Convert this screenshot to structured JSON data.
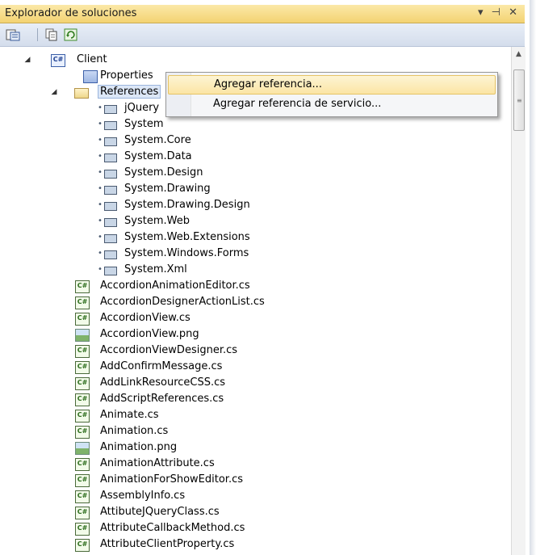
{
  "panel": {
    "title": "Explorador de soluciones",
    "controls": "▾ ⊣ ✕"
  },
  "toolbar": {
    "buttons": [
      {
        "name": "properties-button",
        "icon": "properties-icon"
      },
      {
        "name": "show-all-files-button",
        "icon": "show-all-files-icon"
      },
      {
        "name": "refresh-button",
        "icon": "refresh-icon"
      }
    ]
  },
  "tree": {
    "project": {
      "label": "Client",
      "icon": "csharp-project-icon"
    },
    "properties": {
      "label": "Properties"
    },
    "references": {
      "label": "References",
      "items": [
        "jQuery",
        "System",
        "System.Core",
        "System.Data",
        "System.Design",
        "System.Drawing",
        "System.Drawing.Design",
        "System.Web",
        "System.Web.Extensions",
        "System.Windows.Forms",
        "System.Xml"
      ]
    },
    "files": [
      {
        "label": "AccordionAnimationEditor.cs",
        "type": "cs"
      },
      {
        "label": "AccordionDesignerActionList.cs",
        "type": "cs"
      },
      {
        "label": "AccordionView.cs",
        "type": "cs"
      },
      {
        "label": "AccordionView.png",
        "type": "png"
      },
      {
        "label": "AccordionViewDesigner.cs",
        "type": "cs"
      },
      {
        "label": "AddConfirmMessage.cs",
        "type": "cs"
      },
      {
        "label": "AddLinkResourceCSS.cs",
        "type": "cs"
      },
      {
        "label": "AddScriptReferences.cs",
        "type": "cs"
      },
      {
        "label": "Animate.cs",
        "type": "cs"
      },
      {
        "label": "Animation.cs",
        "type": "cs"
      },
      {
        "label": "Animation.png",
        "type": "png"
      },
      {
        "label": "AnimationAttribute.cs",
        "type": "cs"
      },
      {
        "label": "AnimationForShowEditor.cs",
        "type": "cs"
      },
      {
        "label": "AssemblyInfo.cs",
        "type": "cs"
      },
      {
        "label": "AttibuteJQueryClass.cs",
        "type": "cs"
      },
      {
        "label": "AttributeCallbackMethod.cs",
        "type": "cs"
      },
      {
        "label": "AttributeClientProperty.cs",
        "type": "cs"
      }
    ]
  },
  "context_menu": {
    "items": [
      {
        "label": "Agregar referencia...",
        "highlighted": true
      },
      {
        "label": "Agregar referencia de servicio...",
        "highlighted": false
      }
    ]
  },
  "colors": {
    "title_bar": "#f3d372",
    "toolbar": "#d4ddec",
    "menu_highlight": "#fbe5a5"
  }
}
